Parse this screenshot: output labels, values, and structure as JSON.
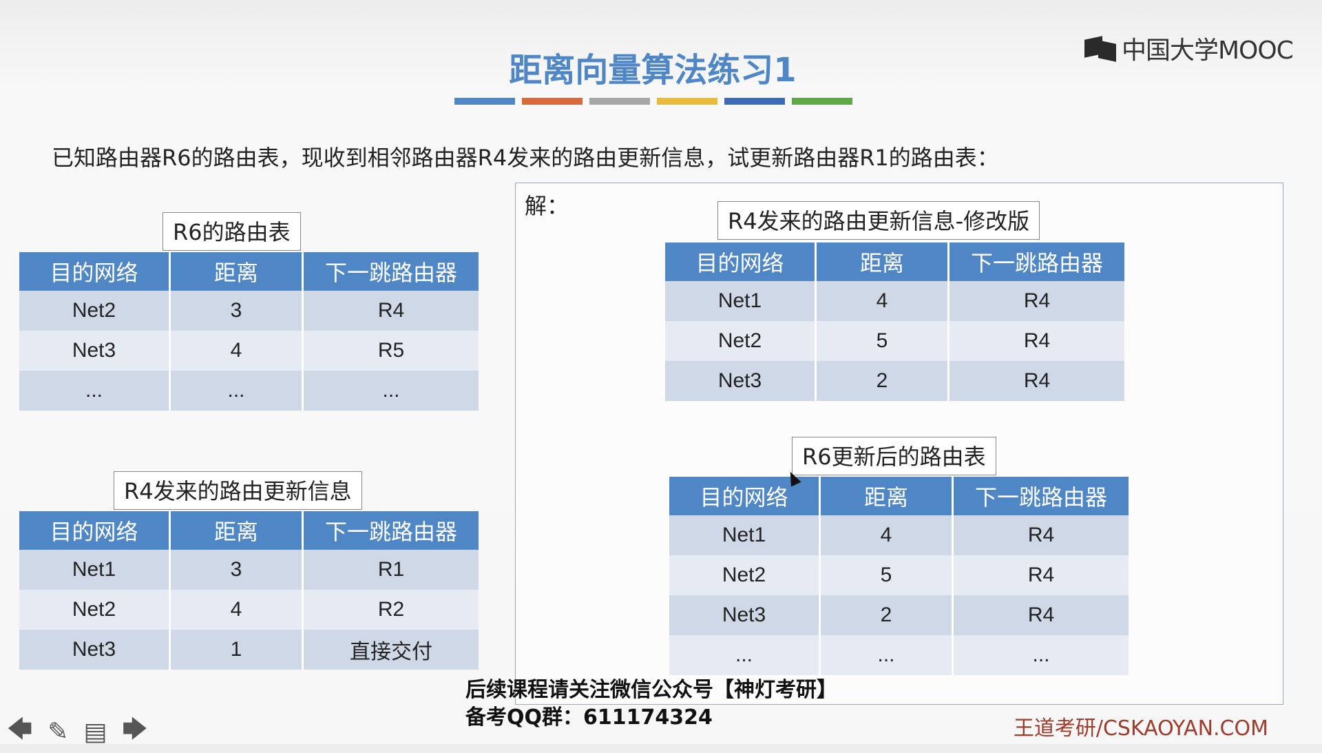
{
  "slide": {
    "title": "距离向量算法练习1",
    "question": "已知路由器R6的路由表，现收到相邻路由器R4发来的路由更新信息，试更新路由器R1的路由表：",
    "solution_label": "解："
  },
  "logo": {
    "text": "中国大学MOOC"
  },
  "accent_bars": [
    "#4f86c6",
    "#d86a3c",
    "#a6a6a6",
    "#e8b93a",
    "#3e6cb4",
    "#5fa845"
  ],
  "headers": {
    "dest": "目的网络",
    "dist": "距离",
    "next": "下一跳路由器"
  },
  "tables": {
    "r6": {
      "label": "R6的路由表",
      "rows": [
        {
          "dest": "Net2",
          "dist": "3",
          "next": "R4"
        },
        {
          "dest": "Net3",
          "dist": "4",
          "next": "R5"
        },
        {
          "dest": "...",
          "dist": "...",
          "next": "..."
        }
      ]
    },
    "r4": {
      "label": "R4发来的路由更新信息",
      "rows": [
        {
          "dest": "Net1",
          "dist": "3",
          "next": "R1"
        },
        {
          "dest": "Net2",
          "dist": "4",
          "next": "R2"
        },
        {
          "dest": "Net3",
          "dist": "1",
          "next": "直接交付"
        }
      ]
    },
    "r4mod": {
      "label": "R4发来的路由更新信息-修改版",
      "rows": [
        {
          "dest": "Net1",
          "dist": "4",
          "next": "R4"
        },
        {
          "dest": "Net2",
          "dist": "5",
          "next": "R4"
        },
        {
          "dest": "Net3",
          "dist": "2",
          "next": "R4"
        }
      ]
    },
    "r6new": {
      "label": "R6更新后的路由表",
      "rows": [
        {
          "dest": "Net1",
          "dist": "4",
          "next": "R4"
        },
        {
          "dest": "Net2",
          "dist": "5",
          "next": "R4"
        },
        {
          "dest": "Net3",
          "dist": "2",
          "next": "R4"
        },
        {
          "dest": "...",
          "dist": "...",
          "next": "..."
        }
      ]
    }
  },
  "footer": {
    "line1": "后续课程请关注微信公众号【神灯考研】",
    "line2": "备考QQ群：611174324",
    "brand": "王道考研/CSKAOYAN.COM"
  },
  "nav": {
    "prev": "🡄",
    "pen": "✎",
    "menu": "▤",
    "next": "🡆"
  }
}
